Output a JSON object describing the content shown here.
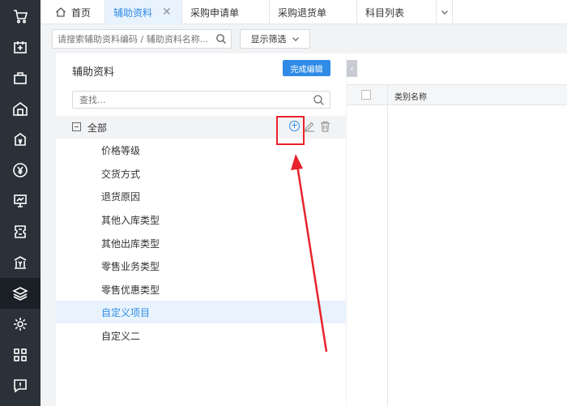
{
  "tabs": [
    {
      "label": "首页"
    },
    {
      "label": "辅助资料"
    },
    {
      "label": "采购申请单"
    },
    {
      "label": "采购退货单"
    },
    {
      "label": "科目列表"
    }
  ],
  "search": {
    "placeholder": "请搜索辅助资料编码 / 辅助资料名称..."
  },
  "filter_button": {
    "label": "显示筛选"
  },
  "panel": {
    "title": "辅助资料",
    "done_button": "完成编辑",
    "find_placeholder": "查找...",
    "root_label": "全部",
    "items": [
      {
        "label": "价格等级"
      },
      {
        "label": "交货方式"
      },
      {
        "label": "退货原因"
      },
      {
        "label": "其他入库类型"
      },
      {
        "label": "其他出库类型"
      },
      {
        "label": "零售业务类型"
      },
      {
        "label": "零售优惠类型"
      },
      {
        "label": "自定义项目"
      },
      {
        "label": "自定义二"
      }
    ]
  },
  "table": {
    "columns": [
      "类别名称"
    ]
  },
  "colors": {
    "accent": "#2f8be6",
    "sidebar": "#2b3139",
    "highlight": "#e8232b"
  }
}
